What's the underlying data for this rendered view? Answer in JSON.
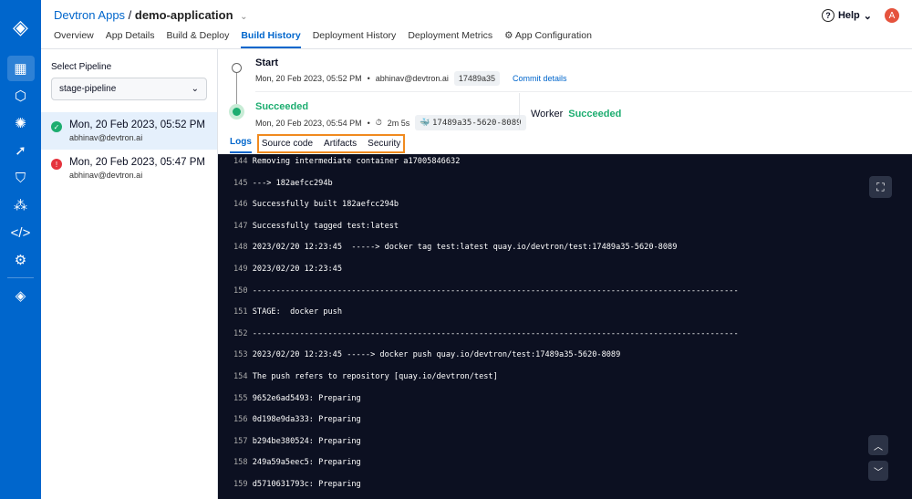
{
  "header": {
    "app": "Devtron Apps",
    "sep": " / ",
    "name": "demo-application",
    "help": "Help",
    "avatar": "A",
    "tabs": [
      "Overview",
      "App Details",
      "Build & Deploy",
      "Build History",
      "Deployment History",
      "Deployment Metrics",
      "App Configuration"
    ]
  },
  "sidebar": {
    "label": "Select Pipeline",
    "pipeline": "stage-pipeline",
    "builds": [
      {
        "date": "Mon, 20 Feb 2023, 05:52 PM",
        "user": "abhinav@devtron.ai",
        "status": "success"
      },
      {
        "date": "Mon, 20 Feb 2023, 05:47 PM",
        "user": "abhinav@devtron.ai",
        "status": "failed"
      }
    ]
  },
  "build": {
    "start_title": "Start",
    "start_date": "Mon, 20 Feb 2023, 05:52 PM",
    "user": "abhinav@devtron.ai",
    "commit": "17489a35",
    "commit_link": "Commit details",
    "status": "Succeeded",
    "end_date": "Mon, 20 Feb 2023, 05:54 PM",
    "duration": "2m 5s",
    "image": "17489a35-5620-8089",
    "worker_label": "Worker",
    "worker_status": "Succeeded",
    "bullet": "•"
  },
  "log_tabs": [
    "Logs",
    "Source code",
    "Artifacts",
    "Security"
  ],
  "logs": [
    {
      "n": "144",
      "t": "Removing intermediate container a17005846632"
    },
    {
      "n": "145",
      "t": "---> 182aefcc294b"
    },
    {
      "n": "146",
      "t": "Successfully built 182aefcc294b"
    },
    {
      "n": "147",
      "t": "Successfully tagged test:latest"
    },
    {
      "n": "148",
      "t": "2023/02/20 12:23:45  -----> docker tag test:latest quay.io/devtron/test:17489a35-5620-8089"
    },
    {
      "n": "149",
      "t": "2023/02/20 12:23:45"
    },
    {
      "n": "150",
      "t": "-------------------------------------------------------------------------------------------------------"
    },
    {
      "n": "151",
      "t": "STAGE:  docker push"
    },
    {
      "n": "152",
      "t": "-------------------------------------------------------------------------------------------------------"
    },
    {
      "n": "153",
      "t": "2023/02/20 12:23:45 -----> docker push quay.io/devtron/test:17489a35-5620-8089"
    },
    {
      "n": "154",
      "t": "The push refers to repository [quay.io/devtron/test]"
    },
    {
      "n": "155",
      "t": "9652e6ad5493: Preparing"
    },
    {
      "n": "156",
      "t": "0d198e9da333: Preparing"
    },
    {
      "n": "157",
      "t": "b294be380524: Preparing"
    },
    {
      "n": "158",
      "t": "249a59a5eec5: Preparing"
    },
    {
      "n": "159",
      "t": "d5710631793c: Preparing"
    }
  ]
}
